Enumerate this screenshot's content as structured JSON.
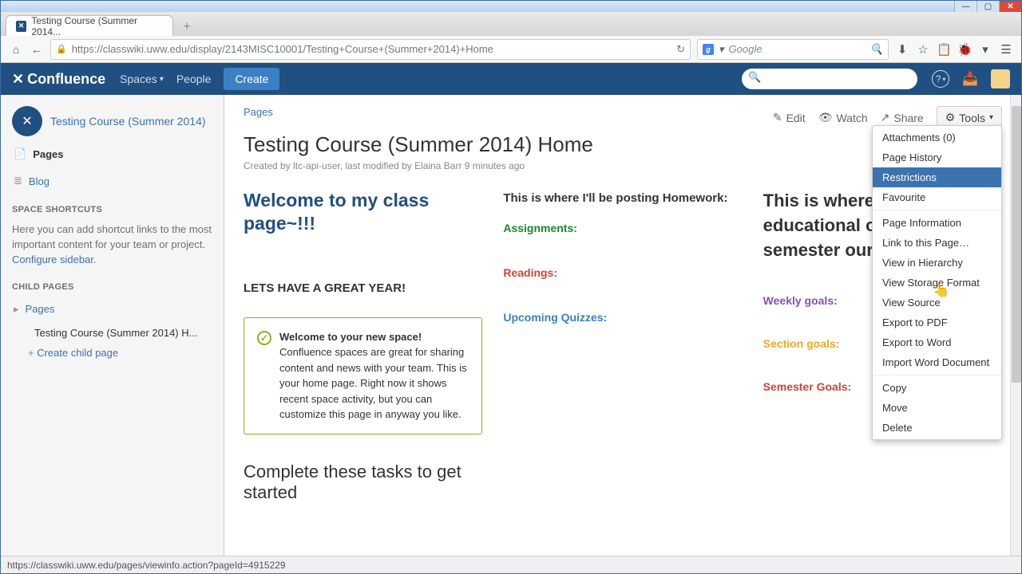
{
  "window": {
    "tab_title": "Testing Course (Summer 2014..."
  },
  "browser": {
    "url": "https://classwiki.uww.edu/display/2143MISC10001/Testing+Course+(Summer+2014)+Home",
    "search_placeholder": "Google",
    "status_url": "https://classwiki.uww.edu/pages/viewinfo.action?pageId=4915229"
  },
  "confluence": {
    "logo": "Confluence",
    "nav": {
      "spaces": "Spaces",
      "people": "People",
      "create": "Create"
    },
    "search_placeholder": ""
  },
  "sidebar": {
    "space_name": "Testing Course (Summer 2014)",
    "pages": "Pages",
    "blog": "Blog",
    "shortcuts_header": "SPACE SHORTCUTS",
    "shortcuts_note_1": "Here you can add shortcut links to the most important content for your team or project. ",
    "shortcuts_link": "Configure sidebar",
    "child_header": "CHILD PAGES",
    "child_pages": "Pages",
    "child_current": "Testing Course (Summer 2014) H...",
    "create_child": "Create child page"
  },
  "page": {
    "breadcrumb": "Pages",
    "actions": {
      "edit": "Edit",
      "watch": "Watch",
      "share": "Share",
      "tools": "Tools"
    },
    "title": "Testing Course (Summer 2014) Home",
    "meta": "Created by ltc-api-user, last modified by Elaina Barr 9 minutes ago"
  },
  "content": {
    "welcome": "Welcome to my class page~!!!",
    "great_year": "LETS HAVE A GREAT YEAR!",
    "hw_intro": "This is where I'll be posting Homework:",
    "assignments": "Assignments:",
    "readings": "Readings:",
    "quizzes": "Upcoming Quizzes:",
    "edu_intro": "This is where the educational our current semester our week:",
    "weekly": "Weekly goals:",
    "section": "Section goals:",
    "semester": "Semester Goals:",
    "panel_title": "Welcome to your new space!",
    "panel_body": "Confluence spaces are great for sharing content and news with your team. This is your home page. Right now it shows recent space activity, but you can customize this page in anyway you like.",
    "tasks_heading": "Complete these tasks to get started"
  },
  "tools_menu": {
    "items": [
      "Attachments (0)",
      "Page History",
      "Restrictions",
      "Favourite",
      "Page Information",
      "Link to this Page…",
      "View in Hierarchy",
      "View Storage Format",
      "View Source",
      "Export to PDF",
      "Export to Word",
      "Import Word Document",
      "Copy",
      "Move",
      "Delete"
    ],
    "selected_index": 2,
    "separators_after": [
      3,
      11
    ]
  }
}
